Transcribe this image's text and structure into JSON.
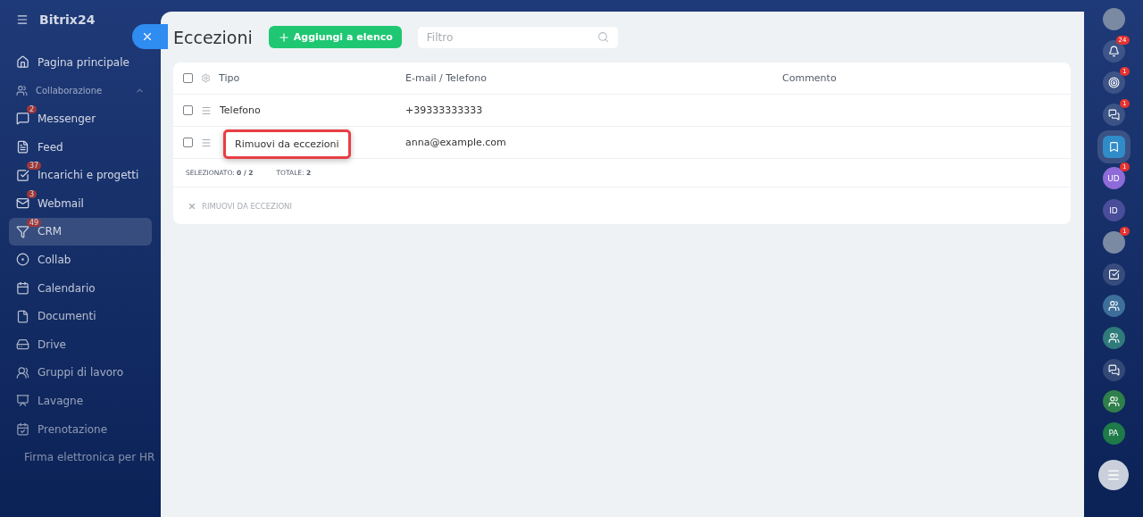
{
  "sidebar": {
    "logo": "Bitrix24",
    "items": [
      {
        "kind": "item",
        "label": "Pagina principale",
        "selected": false
      },
      {
        "kind": "group",
        "label": "Collaborazione",
        "expanded": true
      },
      {
        "kind": "item",
        "label": "Messenger",
        "badge": "2",
        "selected": false
      },
      {
        "kind": "item",
        "label": "Feed",
        "selected": false
      },
      {
        "kind": "item",
        "label": "Incarichi e progetti",
        "badge": "37",
        "selected": false
      },
      {
        "kind": "item",
        "label": "Webmail",
        "badge": "3",
        "selected": false
      },
      {
        "kind": "item",
        "label": "CRM",
        "badge": "49",
        "selected": true
      },
      {
        "kind": "item",
        "label": "Collab",
        "selected": false
      },
      {
        "kind": "item",
        "label": "Calendario",
        "selected": false
      },
      {
        "kind": "item",
        "label": "Documenti",
        "selected": false
      },
      {
        "kind": "item",
        "label": "Drive",
        "selected": false
      },
      {
        "kind": "item",
        "label": "Gruppi di lavoro",
        "selected": false
      },
      {
        "kind": "item",
        "label": "Lavagne",
        "selected": false
      },
      {
        "kind": "item",
        "label": "Prenotazione",
        "selected": false
      },
      {
        "kind": "item",
        "label": "Firma elettronica per HR",
        "selected": false
      }
    ]
  },
  "panel": {
    "title": "Eccezioni",
    "add_button": "Aggiungi a elenco",
    "filter": {
      "placeholder": "Filtro"
    },
    "table": {
      "all_checked": false,
      "columns": [
        "Tipo",
        "E-mail / Telefono",
        "Commento"
      ],
      "rows": [
        {
          "type": "Telefono",
          "contact": "+39333333333",
          "checked": false
        },
        {
          "contact": "anna@example.com",
          "checked": false,
          "context_menu": [
            "Rimuovi da eccezioni"
          ]
        }
      ]
    },
    "footer": {
      "selected_label": "SELEZIONATO:",
      "selected_value": "0 / 2",
      "total_label": "TOTALE:",
      "total_value": "2"
    },
    "action": {
      "label": "RIMUOVI DA ECCEZIONI",
      "disabled": true
    }
  },
  "right_bar": {
    "items": [
      {
        "kind": "avatar",
        "selected": false
      },
      {
        "kind": "bell",
        "badge": "24",
        "selected": false
      },
      {
        "kind": "target",
        "badge": "1",
        "selected": false
      },
      {
        "kind": "chat",
        "badge": "1",
        "selected": false
      },
      {
        "kind": "bookmark",
        "selected": true
      },
      {
        "kind": "initials",
        "text": "UD",
        "badge": "1",
        "selected": false,
        "color": "#8e6bd8"
      },
      {
        "kind": "initials",
        "text": "ID",
        "selected": false,
        "color": "#4a4d9a"
      },
      {
        "kind": "avatar",
        "badge": "1",
        "selected": false
      },
      {
        "kind": "task",
        "selected": false
      },
      {
        "kind": "group",
        "selected": false,
        "color": "#3d6f9a"
      },
      {
        "kind": "group",
        "selected": false,
        "color": "#2f7a7a"
      },
      {
        "kind": "chat",
        "selected": false
      },
      {
        "kind": "group",
        "selected": false,
        "color": "#2f7f4a"
      },
      {
        "kind": "initials",
        "text": "PA",
        "selected": false,
        "color": "#1e7a48"
      },
      {
        "kind": "menu"
      }
    ]
  }
}
